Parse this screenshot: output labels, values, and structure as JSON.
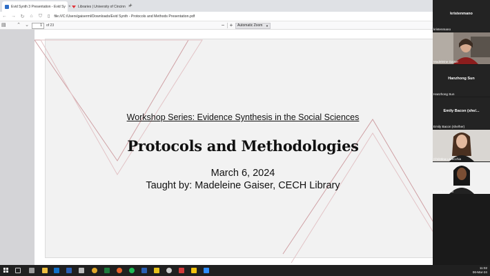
{
  "browser": {
    "tabs": [
      {
        "label": "Evid Synth 3 Presentation - Evid Sy",
        "active": true,
        "favicon_color": "#2f6ec6"
      },
      {
        "label": "Libraries | University of Cincinn",
        "active": false,
        "favicon_color": "#e0343a"
      }
    ],
    "new_tab_glyph": "+",
    "url": "file:///C:/Users/gaiserml/Downloads/Evid Synth - Protocols and Methods Presentation.pdf"
  },
  "pdf_toolbar": {
    "page_number": "1",
    "page_count": "of 23",
    "zoom_label": "Automatic Zoom"
  },
  "slide": {
    "workshop_series": "Workshop Series: Evidence Synthesis in the Social Sciences",
    "title": "Protocols and Methodologies",
    "date": "March 6, 2024",
    "presenter": "Taught by: Madeleine Gaiser, CECH Library"
  },
  "participants": [
    {
      "big_name": "kristenmano",
      "label": "kristenmano",
      "has_video": false
    },
    {
      "big_name": "",
      "label": "Madeleine Gaiser",
      "has_video": true
    },
    {
      "big_name": "Hanzhong Sun",
      "label": "Hanzhong Sun",
      "has_video": false
    },
    {
      "big_name": "Emily Bacon (she/...",
      "label": "Emily Bacon (she/her)",
      "has_video": false
    },
    {
      "big_name": "",
      "label": "Christina Lavecchia",
      "has_video": true
    },
    {
      "big_name": "",
      "label": "Kryste N Knox",
      "has_video": true
    }
  ],
  "taskbar": {
    "time": "11:02",
    "date": "06-Mar-24",
    "icons": [
      "start-icon",
      "task-view-icon",
      "file-explorer-icon",
      "outlook-icon",
      "word-icon",
      "excel-icon",
      "chrome-icon",
      "edge-icon",
      "firefox-icon",
      "spotify-icon",
      "word-doc-icon",
      "media-icon",
      "clock-app-icon",
      "app-icon",
      "note-icon",
      "zoom-icon"
    ]
  },
  "colors": {
    "accent_red": "#c9868b",
    "taskbar": "#202020",
    "panel": "#1a1a1a"
  }
}
